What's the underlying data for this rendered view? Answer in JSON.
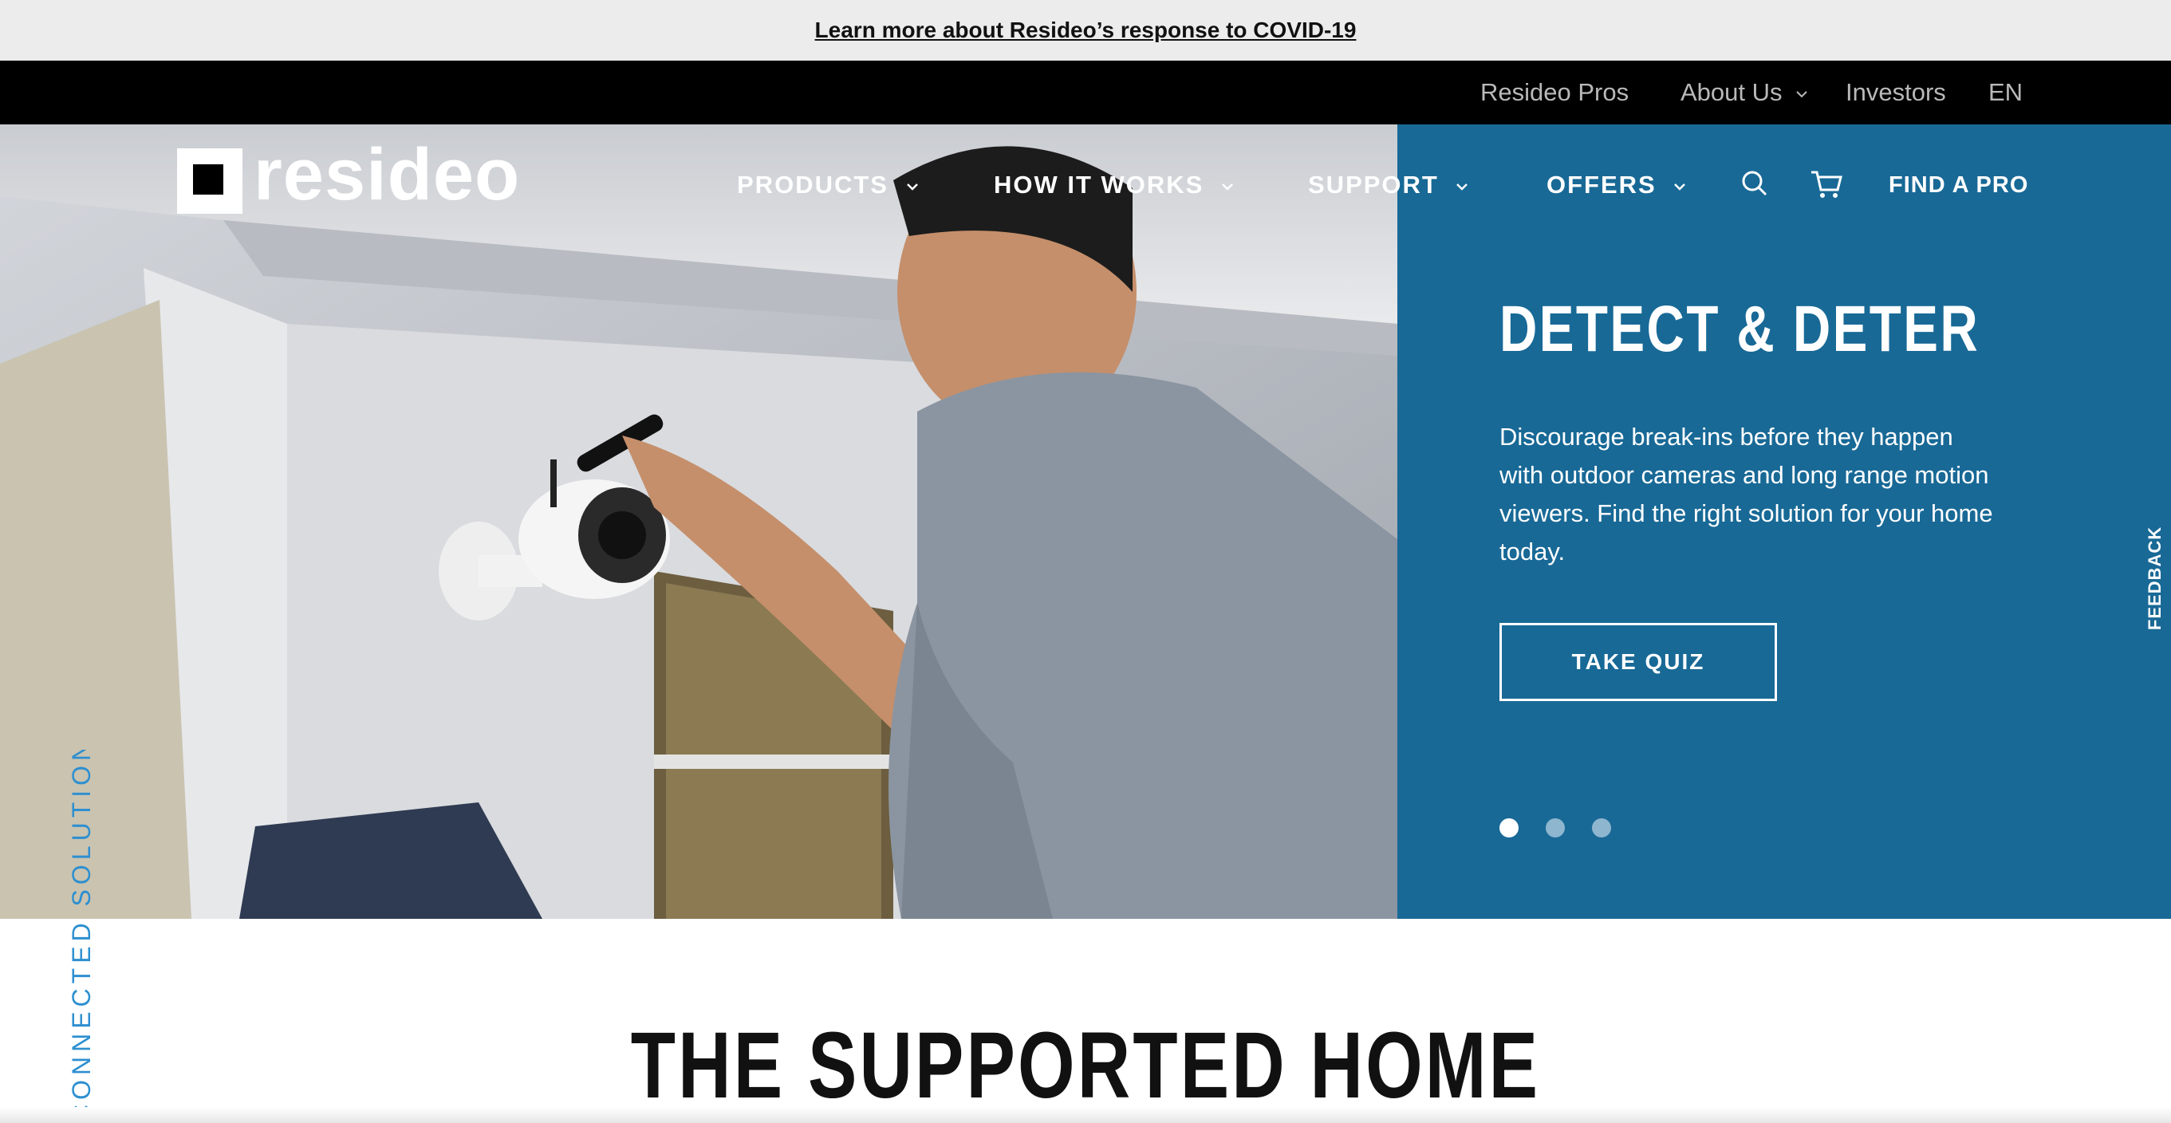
{
  "announcement": {
    "link_text": "Learn more about Resideo’s response to COVID-19"
  },
  "utility_nav": {
    "items": [
      "Resideo Pros",
      "About Us",
      "Investors",
      "EN"
    ]
  },
  "logo": {
    "text": "resideo"
  },
  "main_nav": {
    "items": [
      "PRODUCTS",
      "HOW IT WORKS",
      "SUPPORT",
      "OFFERS"
    ],
    "find_pro": "FIND A PRO",
    "icons": [
      "search-icon",
      "cart-icon",
      "chevron-down-icon"
    ]
  },
  "hero": {
    "title": "DETECT & DETER",
    "description": "Discourage break-ins before they happen with outdoor cameras and long range motion viewers. Find the right solution for your home today.",
    "cta": "TAKE QUIZ",
    "slides": {
      "count": 3,
      "active": 1
    }
  },
  "feedback": {
    "label": "FEEDBACK"
  },
  "side_label": "CONNECTED SOLUTIONS",
  "section": {
    "title": "THE SUPPORTED HOME"
  },
  "colors": {
    "panel_blue": "#186996",
    "side_label_blue": "#2d8fd0",
    "announcement_bg": "#ececec",
    "utility_bg": "#000000"
  }
}
